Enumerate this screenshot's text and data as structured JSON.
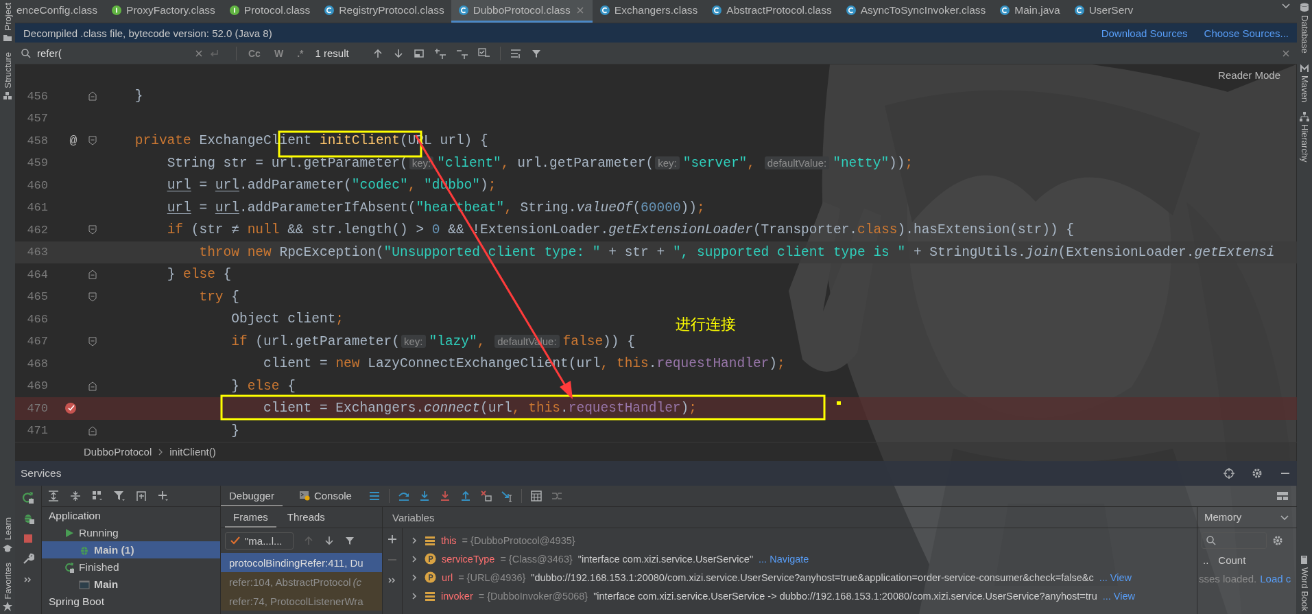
{
  "left_toolbar": {
    "top": [
      "Project",
      "Structure"
    ],
    "bottom": [
      "Learn",
      "Favorites"
    ]
  },
  "right_toolbar": {
    "top": [
      "Database",
      "Maven",
      "Hierarchy"
    ],
    "bottom": [
      "Word Book"
    ]
  },
  "editor_tabs": [
    {
      "label": "enceConfig.class",
      "kind": "plain",
      "selected": false
    },
    {
      "label": "ProxyFactory.class",
      "kind": "interface",
      "selected": false
    },
    {
      "label": "Protocol.class",
      "kind": "interface",
      "selected": false
    },
    {
      "label": "RegistryProtocol.class",
      "kind": "class",
      "selected": false
    },
    {
      "label": "DubboProtocol.class",
      "kind": "class",
      "selected": true
    },
    {
      "label": "Exchangers.class",
      "kind": "class",
      "selected": false
    },
    {
      "label": "AbstractProtocol.class",
      "kind": "class",
      "selected": false
    },
    {
      "label": "AsyncToSyncInvoker.class",
      "kind": "class",
      "selected": false
    },
    {
      "label": "Main.java",
      "kind": "class",
      "selected": false
    },
    {
      "label": "UserServ",
      "kind": "class",
      "selected": false
    }
  ],
  "info_bar": {
    "text": "Decompiled .class file, bytecode version: 52.0 (Java 8)",
    "links": [
      "Download Sources",
      "Choose Sources..."
    ]
  },
  "search": {
    "value": "refer(",
    "options": [
      {
        "label": "Cc",
        "selected": false
      },
      {
        "label": "W",
        "selected": false
      },
      {
        "label": ".*",
        "selected": false
      }
    ],
    "result": "1 result"
  },
  "editor": {
    "reader_mode": "Reader Mode",
    "lines": [
      {
        "number": "456",
        "fold_start": false,
        "fold_end": true,
        "current": false,
        "breakpoint": false,
        "tokens": [
          {
            "kind": "plain",
            "text": "    }"
          }
        ]
      },
      {
        "number": "457",
        "fold_start": false,
        "fold_end": false,
        "current": false,
        "breakpoint": false
      },
      {
        "number": "458",
        "fold_start": true,
        "fold_end": false,
        "current": false,
        "breakpoint": false,
        "gutter_mark": "@",
        "tokens": [
          {
            "kind": "keyword",
            "text": "    private "
          },
          {
            "kind": "plain",
            "text": "ExchangeClient "
          },
          {
            "kind": "method",
            "text": "initClient"
          },
          {
            "kind": "plain",
            "text": "(URL url) {"
          }
        ]
      },
      {
        "number": "459",
        "fold_start": false,
        "fold_end": false,
        "current": false,
        "breakpoint": false,
        "tokens": [
          {
            "kind": "plain",
            "text": "        String str = url.getParameter("
          },
          {
            "kind": "hint",
            "text": "key:"
          },
          {
            "kind": "string",
            "text": "\"client\""
          },
          {
            "kind": "punct",
            "text": ", "
          },
          {
            "kind": "plain",
            "text": "url.getParameter("
          },
          {
            "kind": "hint",
            "text": "key:"
          },
          {
            "kind": "string",
            "text": "\"server\""
          },
          {
            "kind": "punct",
            "text": ", "
          },
          {
            "kind": "hint",
            "text": "defaultValue:"
          },
          {
            "kind": "string",
            "text": "\"netty\""
          },
          {
            "kind": "plain",
            "text": "))"
          },
          {
            "kind": "punct",
            "text": ";"
          }
        ]
      },
      {
        "number": "460",
        "fold_start": false,
        "fold_end": false,
        "current": false,
        "breakpoint": false,
        "tokens": [
          {
            "kind": "var",
            "text": "        url"
          },
          {
            "kind": "plain",
            "text": " = "
          },
          {
            "kind": "var",
            "text": "url"
          },
          {
            "kind": "plain",
            "text": ".addParameter("
          },
          {
            "kind": "string",
            "text": "\"codec\""
          },
          {
            "kind": "punct",
            "text": ", "
          },
          {
            "kind": "string",
            "text": "\"dubbo\""
          },
          {
            "kind": "plain",
            "text": ")"
          },
          {
            "kind": "punct",
            "text": ";"
          }
        ]
      },
      {
        "number": "461",
        "fold_start": false,
        "fold_end": false,
        "current": false,
        "breakpoint": false,
        "tokens": [
          {
            "kind": "var",
            "text": "        url"
          },
          {
            "kind": "plain",
            "text": " = "
          },
          {
            "kind": "var",
            "text": "url"
          },
          {
            "kind": "plain",
            "text": ".addParameterIfAbsent("
          },
          {
            "kind": "string",
            "text": "\"heartbeat\""
          },
          {
            "kind": "punct",
            "text": ", "
          },
          {
            "kind": "plain",
            "text": "String."
          },
          {
            "kind": "static",
            "text": "valueOf"
          },
          {
            "kind": "plain",
            "text": "("
          },
          {
            "kind": "number",
            "text": "60000"
          },
          {
            "kind": "plain",
            "text": "))"
          },
          {
            "kind": "punct",
            "text": ";"
          }
        ]
      },
      {
        "number": "462",
        "fold_start": true,
        "fold_end": false,
        "current": false,
        "breakpoint": false,
        "tokens": [
          {
            "kind": "keyword",
            "text": "        if "
          },
          {
            "kind": "plain",
            "text": "(str ≠ "
          },
          {
            "kind": "keyword",
            "text": "null "
          },
          {
            "kind": "plain",
            "text": "&& str.length() > "
          },
          {
            "kind": "number",
            "text": "0"
          },
          {
            "kind": "plain",
            "text": " && !ExtensionLoader."
          },
          {
            "kind": "static",
            "text": "getExtensionLoader"
          },
          {
            "kind": "plain",
            "text": "(Transporter."
          },
          {
            "kind": "keyword",
            "text": "class"
          },
          {
            "kind": "plain",
            "text": ").hasExtension(str)) {"
          }
        ]
      },
      {
        "number": "463",
        "fold_start": false,
        "fold_end": false,
        "current": true,
        "breakpoint": false,
        "tokens": [
          {
            "kind": "keyword",
            "text": "            throw new "
          },
          {
            "kind": "plain",
            "text": "RpcException("
          },
          {
            "kind": "string",
            "text": "\"Unsupported client type: \""
          },
          {
            "kind": "plain",
            "text": " + str + "
          },
          {
            "kind": "string",
            "text": "\", supported client type is \""
          },
          {
            "kind": "plain",
            "text": " + StringUtils."
          },
          {
            "kind": "static",
            "text": "join"
          },
          {
            "kind": "plain",
            "text": "(ExtensionLoader."
          },
          {
            "kind": "static",
            "text": "getExtensi"
          }
        ]
      },
      {
        "number": "464",
        "fold_start": false,
        "fold_end": true,
        "current": false,
        "breakpoint": false,
        "tokens": [
          {
            "kind": "plain",
            "text": "        } "
          },
          {
            "kind": "keyword",
            "text": "else "
          },
          {
            "kind": "plain",
            "text": "{"
          }
        ]
      },
      {
        "number": "465",
        "fold_start": true,
        "fold_end": false,
        "current": false,
        "breakpoint": false,
        "tokens": [
          {
            "kind": "keyword",
            "text": "            try "
          },
          {
            "kind": "plain",
            "text": "{"
          }
        ]
      },
      {
        "number": "466",
        "fold_start": false,
        "fold_end": false,
        "current": false,
        "breakpoint": false,
        "tokens": [
          {
            "kind": "plain",
            "text": "                Object client"
          },
          {
            "kind": "punct",
            "text": ";"
          }
        ]
      },
      {
        "number": "467",
        "fold_start": true,
        "fold_end": false,
        "current": false,
        "breakpoint": false,
        "tokens": [
          {
            "kind": "keyword",
            "text": "                if "
          },
          {
            "kind": "plain",
            "text": "(url.getParameter("
          },
          {
            "kind": "hint",
            "text": "key:"
          },
          {
            "kind": "string",
            "text": "\"lazy\""
          },
          {
            "kind": "punct",
            "text": ", "
          },
          {
            "kind": "hint",
            "text": "defaultValue:"
          },
          {
            "kind": "keyword",
            "text": "false"
          },
          {
            "kind": "plain",
            "text": ")) {"
          }
        ]
      },
      {
        "number": "468",
        "fold_start": false,
        "fold_end": false,
        "current": false,
        "breakpoint": false,
        "tokens": [
          {
            "kind": "plain",
            "text": "                    client = "
          },
          {
            "kind": "keyword",
            "text": "new "
          },
          {
            "kind": "plain",
            "text": "LazyConnectExchangeClient(url"
          },
          {
            "kind": "punct",
            "text": ", "
          },
          {
            "kind": "keyword",
            "text": "this"
          },
          {
            "kind": "plain",
            "text": "."
          },
          {
            "kind": "field",
            "text": "requestHandler"
          },
          {
            "kind": "plain",
            "text": ")"
          },
          {
            "kind": "punct",
            "text": ";"
          }
        ]
      },
      {
        "number": "469",
        "fold_start": false,
        "fold_end": true,
        "current": false,
        "breakpoint": false,
        "tokens": [
          {
            "kind": "plain",
            "text": "                } "
          },
          {
            "kind": "keyword",
            "text": "else "
          },
          {
            "kind": "plain",
            "text": "{"
          }
        ]
      },
      {
        "number": "470",
        "fold_start": false,
        "fold_end": false,
        "current": false,
        "breakpoint": true,
        "tokens": [
          {
            "kind": "plain",
            "text": "                    client = Exchangers."
          },
          {
            "kind": "static",
            "text": "connect"
          },
          {
            "kind": "plain",
            "text": "(url"
          },
          {
            "kind": "punct",
            "text": ", "
          },
          {
            "kind": "keyword",
            "text": "this"
          },
          {
            "kind": "plain",
            "text": "."
          },
          {
            "kind": "field",
            "text": "requestHandler"
          },
          {
            "kind": "plain",
            "text": ")"
          },
          {
            "kind": "punct",
            "text": ";"
          }
        ]
      },
      {
        "number": "471",
        "fold_start": false,
        "fold_end": true,
        "current": false,
        "breakpoint": false,
        "tokens": [
          {
            "kind": "plain",
            "text": "                }"
          }
        ]
      }
    ]
  },
  "breadcrumbs": [
    "DubboProtocol",
    "initClient()"
  ],
  "annotations": [
    {
      "kind": "box",
      "color": "#ffff00"
    },
    {
      "kind": "box",
      "color": "#ffff00"
    },
    {
      "kind": "arrow",
      "color": "#ff3b3b"
    },
    {
      "kind": "note",
      "color": "#ffff00",
      "text": "进行连接"
    },
    {
      "kind": "dot",
      "color": "#ffff00"
    }
  ],
  "services": {
    "title": "Services",
    "tree": [
      {
        "label": "Application",
        "kind": "group",
        "selected": false,
        "children": [
          {
            "label": "Running",
            "kind": "running",
            "selected": false,
            "children": [
              {
                "label": "Main (1)",
                "kind": "debug",
                "selected": true
              }
            ]
          },
          {
            "label": "Finished",
            "kind": "finished",
            "selected": false,
            "children": [
              {
                "label": "Main",
                "kind": "app",
                "selected": false
              }
            ]
          }
        ]
      },
      {
        "label": "Spring Boot",
        "kind": "group",
        "selected": false
      }
    ]
  },
  "debugger": {
    "tabs": [
      {
        "label": "Debugger",
        "selected": true
      },
      {
        "label": "Console",
        "selected": false
      }
    ],
    "frame_tabs": [
      {
        "label": "Frames",
        "selected": true
      },
      {
        "label": "Threads",
        "selected": false
      }
    ],
    "thread": "\"ma...l...",
    "frames": [
      {
        "text": "protocolBindingRefer:411, Du",
        "kind": "own",
        "selected": true
      },
      {
        "text": "refer:104, AbstractProtocol *(c*",
        "kind": "library",
        "selected": false
      },
      {
        "text": "refer:74, ProtocolListenerWra",
        "kind": "library",
        "selected": false
      }
    ],
    "variables_title": "Variables",
    "variables": [
      {
        "name": "this",
        "kind": "field",
        "type": "= {DubboProtocol@4935}"
      },
      {
        "name": "serviceType",
        "kind": "param",
        "type": "= {Class@3463}",
        "value": "\"interface com.xizi.service.UserService\"",
        "link": "... Navigate"
      },
      {
        "name": "url",
        "kind": "param",
        "type": "= {URL@4936}",
        "value": "\"dubbo://192.168.153.1:20080/com.xizi.service.UserService?anyhost=true&application=order-service-consumer&check=false&c",
        "link": "... View"
      },
      {
        "name": "invoker",
        "kind": "field",
        "type": "= {DubboInvoker@5068}",
        "value": "\"interface com.xizi.service.UserService -> dubbo://192.168.153.1:20080/com.xizi.service.UserService?anyhost=tru",
        "link": "... View"
      }
    ]
  },
  "memory": {
    "tab": "Memory",
    "column_prefix": "..",
    "column": "Count",
    "status": "sses loaded.",
    "link": "Load c"
  }
}
